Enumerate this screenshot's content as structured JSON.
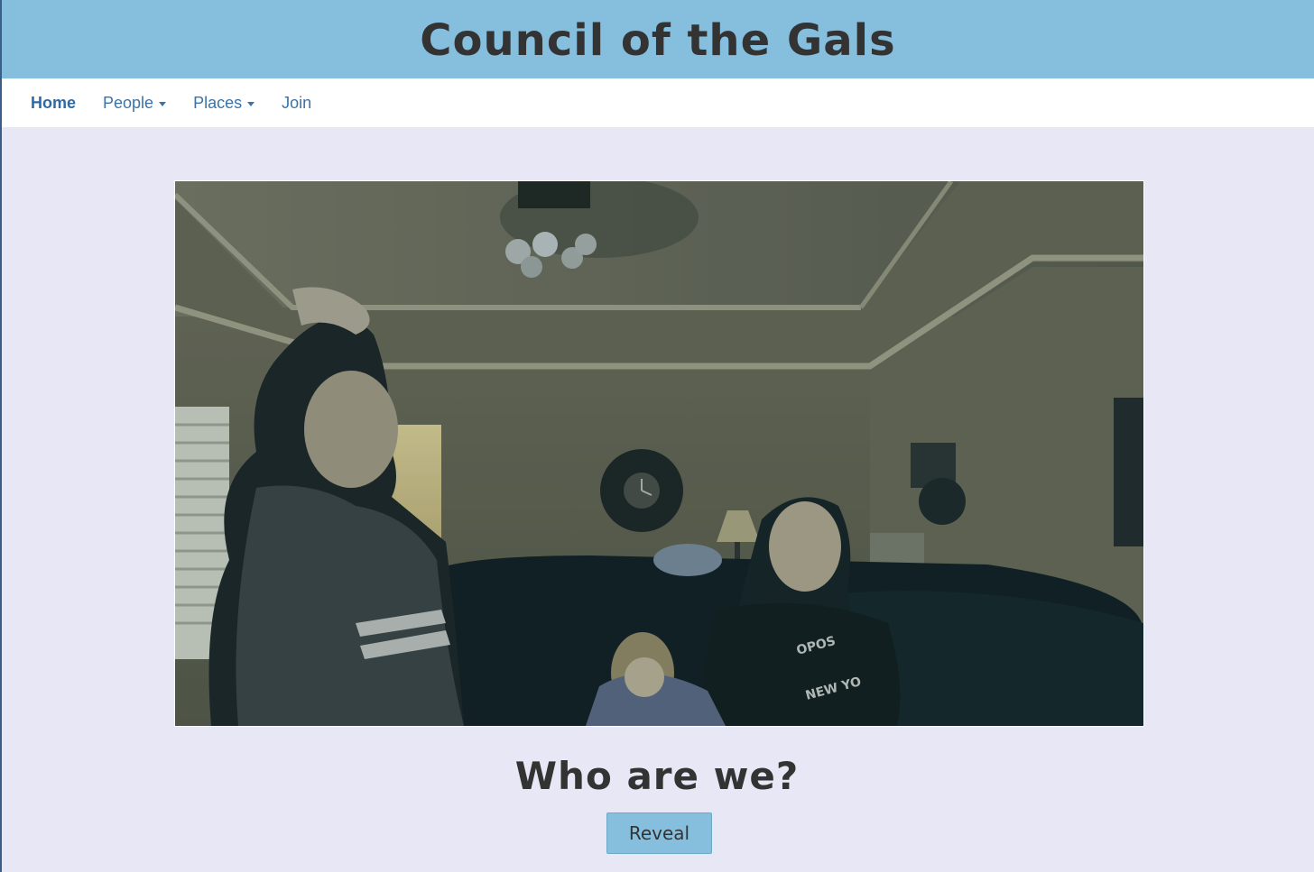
{
  "header": {
    "title": "Council of the Gals"
  },
  "nav": {
    "items": [
      {
        "label": "Home",
        "active": true,
        "dropdown": false
      },
      {
        "label": "People",
        "active": false,
        "dropdown": true
      },
      {
        "label": "Places",
        "active": false,
        "dropdown": true
      },
      {
        "label": "Join",
        "active": false,
        "dropdown": false
      }
    ]
  },
  "main": {
    "heading": "Who are we?",
    "reveal_label": "Reveal"
  },
  "colors": {
    "header_bg": "#85bfdd",
    "page_bg": "#e8e7f5",
    "nav_link": "#3b73a8",
    "button_bg": "#85bfdd"
  }
}
